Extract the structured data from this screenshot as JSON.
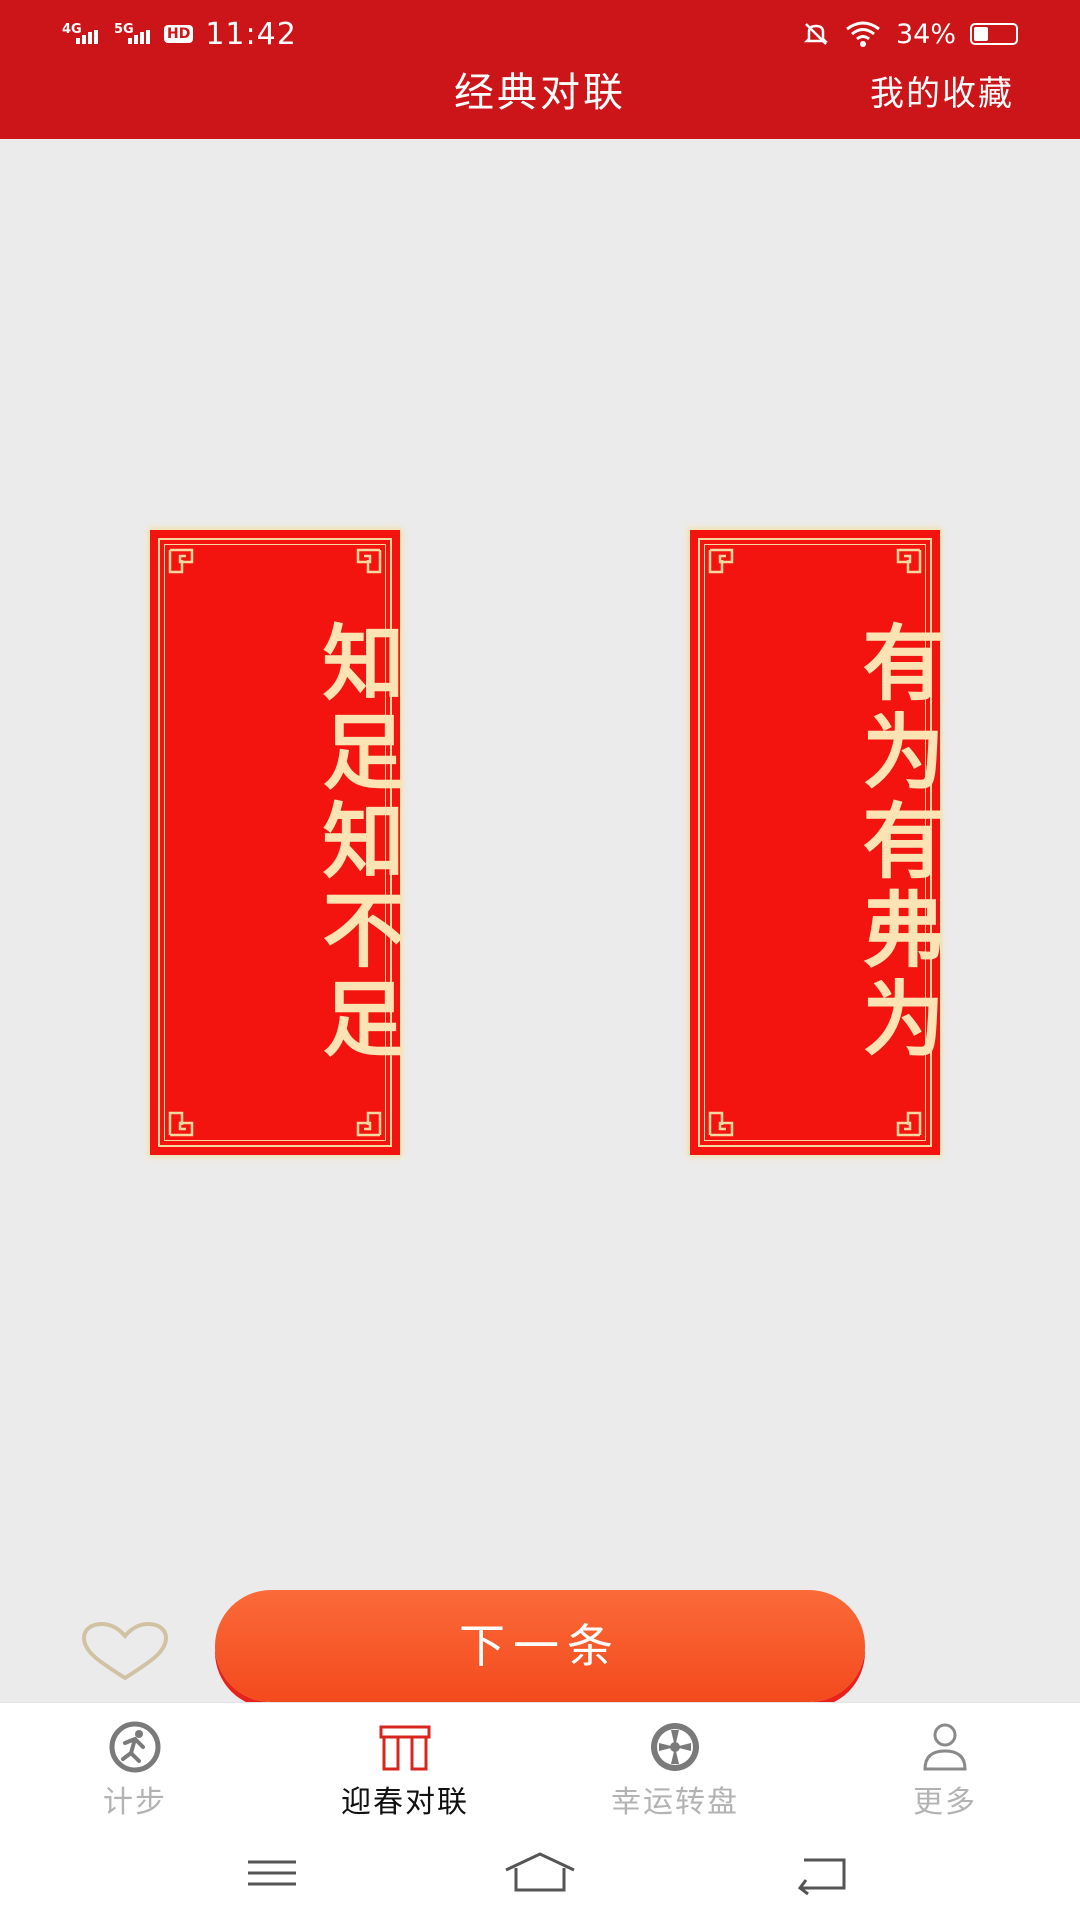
{
  "status_bar": {
    "network1": "4G",
    "network2": "5G",
    "hd": "HD",
    "time": "11:42",
    "battery": "34%",
    "battery_level": 0.34
  },
  "header": {
    "title": "经典对联",
    "favorites_label": "我的收藏"
  },
  "couplet": {
    "left_line": "知足知不足",
    "right_line": "有为有弗为"
  },
  "actions": {
    "next_label": "下一条"
  },
  "tabs": [
    {
      "label": "计步",
      "icon": "running-icon",
      "active": false
    },
    {
      "label": "迎春对联",
      "icon": "couplet-icon",
      "active": true
    },
    {
      "label": "幸运转盘",
      "icon": "wheel-icon",
      "active": false
    },
    {
      "label": "更多",
      "icon": "person-icon",
      "active": false
    }
  ],
  "colors": {
    "header": "#cc1518",
    "couplet_red": "#f4140f",
    "couplet_text": "#fce3b4",
    "button_orange": "#f65a2a"
  }
}
